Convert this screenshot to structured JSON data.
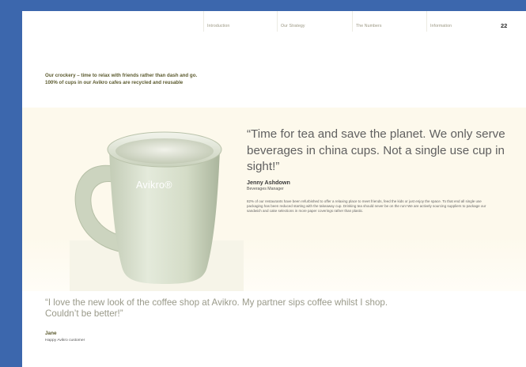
{
  "nav": {
    "items": [
      "Introduction",
      "Our Strategy",
      "The Numbers",
      "Information"
    ],
    "page_number": "22"
  },
  "caption": "Our crockery – time to relax with friends rather than dash and go. 100% of cups in our  Avikro cafes are recycled and reusable",
  "feature": {
    "mug_brand": "Avikro®",
    "quote": "“Time for tea and save the planet. We only serve beverages in china cups. Not a single use cup in sight!”",
    "name": "Jenny Ashdown",
    "role": "Beverages Manager",
    "body": "82% of our restaurants have been refurbished to offer a relaxing place to meet friends, feed the kids or just enjoy the space. To that end all single use packaging has been reduced starting with the takeaway cup. Drinking tea should never be on the run! We are actively sourcing suppliers to package our sandwich and cake selections in more  paper coverings rather than plastic."
  },
  "testimonial": {
    "quote": "“I love the new look of the coffee shop at Avikro. My partner sips coffee whilst I shop. Couldn’t be better!”",
    "name": "Jane",
    "role": "Happy Avikro customer"
  },
  "colors": {
    "frame": "#3c67ad",
    "band": "#fdf9ec",
    "mug": "#d8dfcc",
    "caption_text": "#5b5a2e"
  }
}
